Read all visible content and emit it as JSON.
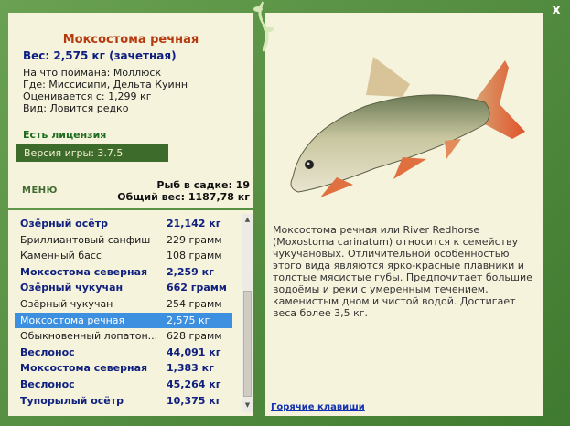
{
  "fish": {
    "title": "Моксостома речная",
    "weight": "Вес: 2,575 кг (зачетная)",
    "caught_on": "На что поймана: Моллюск",
    "location": "Где: Миссисипи, Дельта Куинн",
    "valued": "Оценивается с: 1,299 кг",
    "species": "Вид: Ловится редко",
    "description": "Моксостома речная или River Redhorse (Moxostoma carinatum) относится к семейству чукучановых. Отличительной особенностью этого вида являются ярко-красные плавники и толстые мясистые губы. Предпочитает большие водоёмы и реки с умеренным течением, каменистым дном и чистой водой. Достигает веса более 3,5 кг."
  },
  "license": "Есть лицензия",
  "version": "Версия игры: 3.7.5",
  "menu_label": "МЕНЮ",
  "stats": {
    "fish_in_net": "Рыб в садке: 19",
    "total_weight": "Общий вес: 1187,78 кг"
  },
  "list": [
    {
      "name": "Озёрный осётр",
      "weight": "21,142 кг",
      "style": "bold"
    },
    {
      "name": "Бриллиантовый санфиш",
      "weight": "229 грамм",
      "style": "plain"
    },
    {
      "name": "Каменный басс",
      "weight": "108 грамм",
      "style": "plain"
    },
    {
      "name": "Моксостома северная",
      "weight": "2,259 кг",
      "style": "bold"
    },
    {
      "name": "Озёрный чукучан",
      "weight": "662 грамм",
      "style": "bold"
    },
    {
      "name": "Озёрный чукучан",
      "weight": "254 грамм",
      "style": "plain"
    },
    {
      "name": "Моксостома речная",
      "weight": "2,575 кг",
      "style": "sel"
    },
    {
      "name": "Обыкновенный лопатон...",
      "weight": "628 грамм",
      "style": "plain"
    },
    {
      "name": "Веслонос",
      "weight": "44,091 кг",
      "style": "bold"
    },
    {
      "name": "Моксостома северная",
      "weight": "1,383 кг",
      "style": "bold"
    },
    {
      "name": "Веслонос",
      "weight": "45,264 кг",
      "style": "bold"
    },
    {
      "name": "Тупорылый осётр",
      "weight": "10,375 кг",
      "style": "bold"
    }
  ],
  "hotkeys_label": "Горячие клавиши",
  "close_label": "x"
}
